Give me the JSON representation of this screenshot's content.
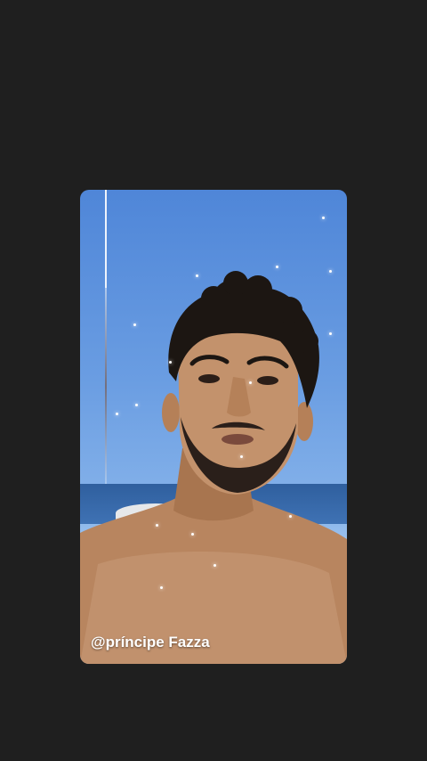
{
  "story": {
    "caption": "@príncipe Fazza"
  },
  "colors": {
    "background": "#1f1f1f",
    "sky_top": "#4f86d8",
    "sky_bottom": "#9cc2ef",
    "sea": "#3f72b4",
    "skin": "#c99a78",
    "hair": "#1c1612"
  }
}
